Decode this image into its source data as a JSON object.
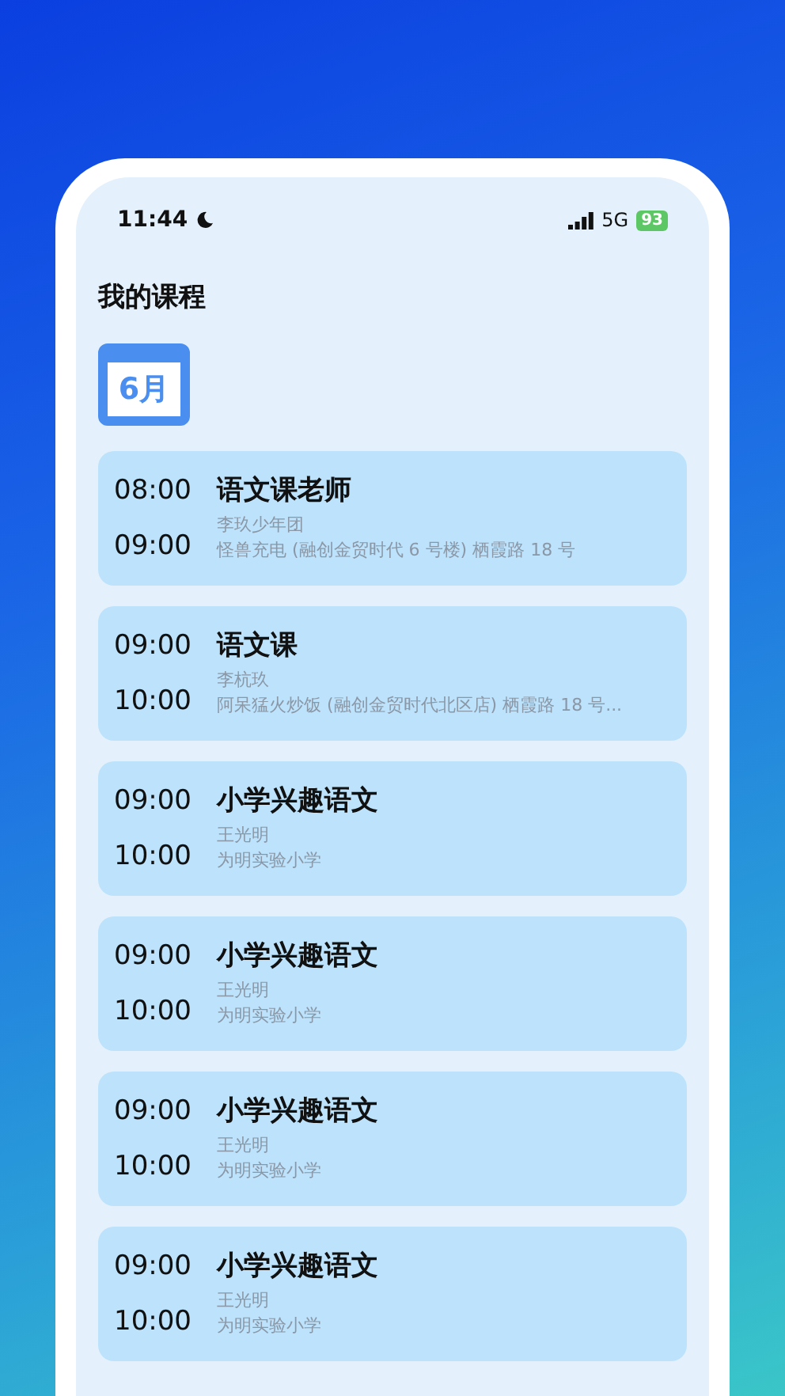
{
  "status_bar": {
    "time": "11:44",
    "network": "5G",
    "battery": "93"
  },
  "title": "我的课程",
  "calendar": {
    "month": "6月"
  },
  "courses": [
    {
      "start": "08:00",
      "end": "09:00",
      "name": "语文课老师",
      "teacher": "李玖少年团",
      "place": "怪兽充电 (融创金贸时代 6 号楼) 栖霞路 18 号"
    },
    {
      "start": "09:00",
      "end": "10:00",
      "name": "语文课",
      "teacher": "李杭玖",
      "place": "阿呆猛火炒饭 (融创金贸时代北区店) 栖霞路 18 号..."
    },
    {
      "start": "09:00",
      "end": "10:00",
      "name": "小学兴趣语文",
      "teacher": "王光明",
      "place": "为明实验小学"
    },
    {
      "start": "09:00",
      "end": "10:00",
      "name": "小学兴趣语文",
      "teacher": "王光明",
      "place": "为明实验小学"
    },
    {
      "start": "09:00",
      "end": "10:00",
      "name": "小学兴趣语文",
      "teacher": "王光明",
      "place": "为明实验小学"
    },
    {
      "start": "09:00",
      "end": "10:00",
      "name": "小学兴趣语文",
      "teacher": "王光明",
      "place": "为明实验小学"
    }
  ]
}
